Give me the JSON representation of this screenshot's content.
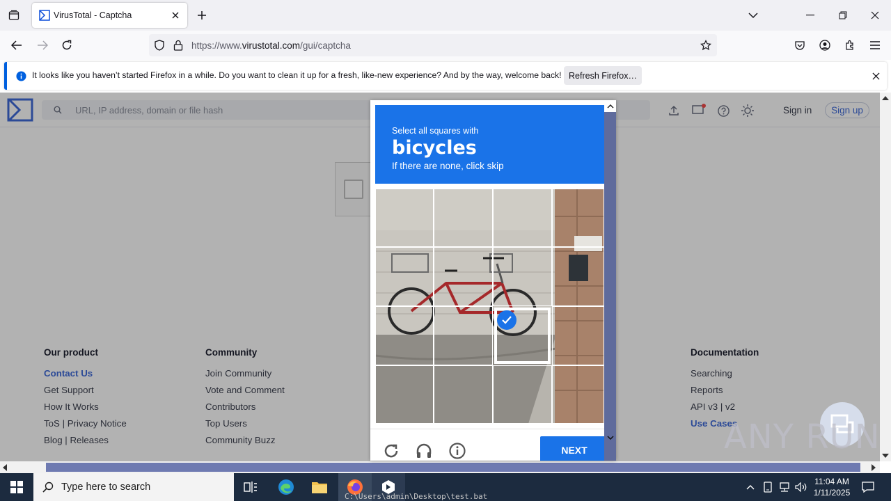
{
  "browser": {
    "tab_title": "VirusTotal - Captcha",
    "url_prefix": "https://www.",
    "url_domain": "virustotal.com",
    "url_path": "/gui/captcha",
    "notification_text": "It looks like you haven’t started Firefox in a while. Do you want to clean it up for a fresh, like-new experience? And by the way, welcome back!",
    "notification_button": "Refresh Firefox…"
  },
  "vt": {
    "search_placeholder": "URL, IP address, domain or file hash",
    "sign_in": "Sign in",
    "sign_up": "Sign up",
    "footer": {
      "col1_title": "Our product",
      "col1_links": [
        "Contact Us",
        "Get Support",
        "How It Works",
        "ToS | Privacy Notice",
        "Blog | Releases"
      ],
      "col2_title": "Community",
      "col2_links": [
        "Join Community",
        "Vote and Comment",
        "Contributors",
        "Top Users",
        "Community Buzz"
      ],
      "col3_title": "Documentation",
      "col3_links": [
        "Searching",
        "Reports",
        "API v3 | v2",
        "Use Cases"
      ]
    }
  },
  "captcha": {
    "instruction": "Select all squares with",
    "target": "bicycles",
    "hint": "If there are none, click skip",
    "next_button": "NEXT",
    "selected_tile": "row 3, column 3"
  },
  "taskbar": {
    "search_placeholder": "Type here to search",
    "time": "11:04 AM",
    "date": "1/11/2025",
    "console_text": "C:\\Users\\admin\\Desktop\\test.bat"
  },
  "watermark": "ANY RUN",
  "colors": {
    "captcha_blue": "#1a73e8",
    "vt_blue": "#3f6bd9",
    "taskbar": "#1c2b3f"
  }
}
